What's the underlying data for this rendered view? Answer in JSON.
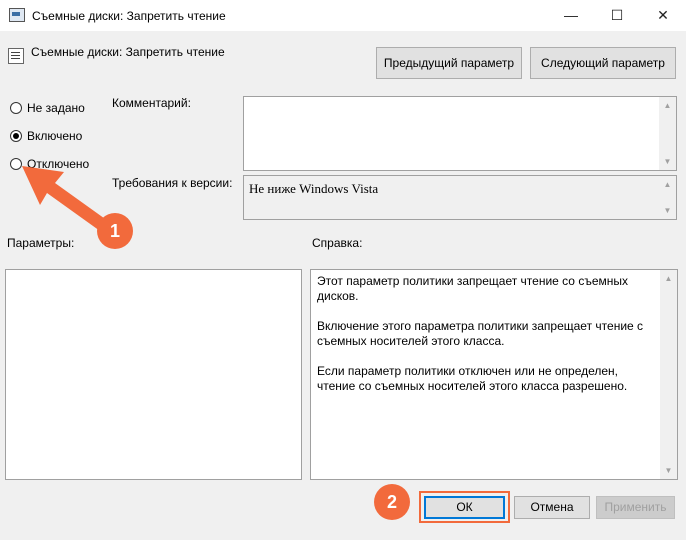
{
  "window": {
    "title": "Съемные диски: Запретить чтение",
    "minimize": "—",
    "maximize": "☐",
    "close": "✕"
  },
  "policy": {
    "name": "Съемные диски: Запретить чтение"
  },
  "nav": {
    "prev_label": "Предыдущий параметр",
    "next_label": "Следующий параметр"
  },
  "state": {
    "options": [
      {
        "label": "Не задано",
        "checked": false
      },
      {
        "label": "Включено",
        "checked": true
      },
      {
        "label": "Отключено",
        "checked": false
      }
    ]
  },
  "comment": {
    "label": "Комментарий:",
    "value": ""
  },
  "version": {
    "label": "Требования к версии:",
    "value": "Не ниже Windows Vista"
  },
  "params": {
    "label": "Параметры:"
  },
  "help": {
    "label": "Справка:",
    "text": "Этот параметр политики запрещает чтение со съемных дисков.\n\nВключение этого параметра политики запрещает чтение с съемных носителей этого класса.\n\nЕсли параметр политики отключен или не определен, чтение со съемных носителей этого класса разрешено."
  },
  "buttons": {
    "ok": "ОК",
    "cancel": "Отмена",
    "apply": "Применить"
  },
  "annotations": {
    "badge1": "1",
    "badge2": "2",
    "accent": "#f26a3c"
  }
}
